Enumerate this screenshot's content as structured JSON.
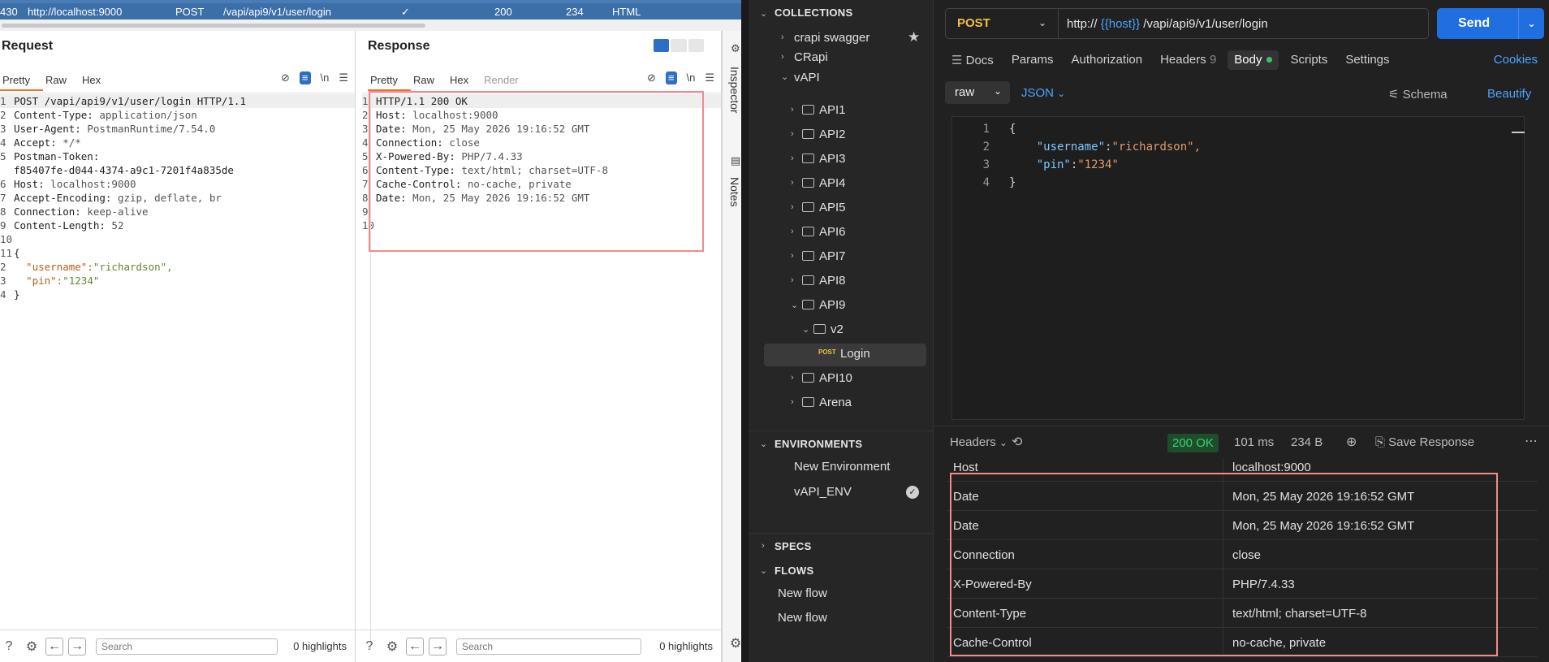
{
  "history": {
    "row": {
      "id": "430",
      "host": "http://localhost:9000",
      "method": "POST",
      "url": "/vapi/api9/v1/user/login",
      "edited": "✓",
      "status": "200",
      "length": "234",
      "mime": "HTML"
    }
  },
  "request": {
    "title": "Request",
    "tabs": [
      "Pretty",
      "Raw",
      "Hex"
    ],
    "lines": [
      {
        "n": "1",
        "k": "POST /vapi/api9/v1/user/login HTTP/1.1",
        "v": ""
      },
      {
        "n": "2",
        "k": "Content-Type:",
        "v": " application/json"
      },
      {
        "n": "3",
        "k": "User-Agent:",
        "v": " PostmanRuntime/7.54.0"
      },
      {
        "n": "4",
        "k": "Accept:",
        "v": " */*"
      },
      {
        "n": "5",
        "k": "Postman-Token:",
        "v": ""
      },
      {
        "n": "",
        "k": "f85407fe-d044-4374-a9c1-7201f4a835de",
        "v": ""
      },
      {
        "n": "6",
        "k": "Host:",
        "v": " localhost:9000"
      },
      {
        "n": "7",
        "k": "Accept-Encoding:",
        "v": " gzip, deflate, br"
      },
      {
        "n": "8",
        "k": "Connection:",
        "v": " keep-alive"
      },
      {
        "n": "9",
        "k": "Content-Length:",
        "v": " 52"
      },
      {
        "n": "10",
        "k": "",
        "v": ""
      },
      {
        "n": "11",
        "k": "{",
        "v": ""
      },
      {
        "n": "2",
        "k": "  \"username\":",
        "v": "\"richardson\","
      },
      {
        "n": "3",
        "k": "  \"pin\":",
        "v": "\"1234\""
      },
      {
        "n": "4",
        "k": "}",
        "v": ""
      }
    ],
    "search_placeholder": "Search",
    "highlights": "0 highlights"
  },
  "response": {
    "title": "Response",
    "tabs": [
      "Pretty",
      "Raw",
      "Hex",
      "Render"
    ],
    "lines": [
      {
        "n": "1",
        "k": "HTTP/1.1 200 OK",
        "v": ""
      },
      {
        "n": "2",
        "k": "Host:",
        "v": " localhost:9000"
      },
      {
        "n": "3",
        "k": "Date:",
        "v": " Mon, 25 May 2026 19:16:52 GMT"
      },
      {
        "n": "4",
        "k": "Connection:",
        "v": " close"
      },
      {
        "n": "5",
        "k": "X-Powered-By:",
        "v": " PHP/7.4.33"
      },
      {
        "n": "6",
        "k": "Content-Type:",
        "v": " text/html; charset=UTF-8"
      },
      {
        "n": "7",
        "k": "Cache-Control:",
        "v": " no-cache, private"
      },
      {
        "n": "8",
        "k": "Date:",
        "v": " Mon, 25 May 2026 19:16:52 GMT"
      },
      {
        "n": "9",
        "k": "",
        "v": ""
      },
      {
        "n": "10",
        "k": "",
        "v": ""
      }
    ],
    "search_placeholder": "Search",
    "highlights": "0 highlights"
  },
  "side": {
    "inspector": "Inspector",
    "notes": "Notes"
  },
  "postman": {
    "collections_label": "COLLECTIONS",
    "collections": [
      {
        "name": "crapi swagger"
      },
      {
        "name": "CRapi"
      },
      {
        "name": "vAPI"
      }
    ],
    "folders": [
      "API1",
      "API2",
      "API3",
      "API4",
      "API5",
      "API6",
      "API7",
      "API8",
      "API9"
    ],
    "subfolder": "v2",
    "request_method": "POST",
    "request_name": "Login",
    "folders_after": [
      "API10",
      "Arena"
    ],
    "environments_label": "ENVIRONMENTS",
    "environments": [
      "New Environment",
      "vAPI_ENV"
    ],
    "specs_label": "SPECS",
    "flows_label": "FLOWS",
    "flows": [
      "New flow",
      "New flow"
    ],
    "method": "POST",
    "url_prefix": "http://",
    "url_var": "{{host}}",
    "url_path": "/vapi/api9/v1/user/login",
    "send": "Send",
    "tabs": [
      "Docs",
      "Params",
      "Authorization",
      "Headers",
      "Body",
      "Scripts",
      "Settings"
    ],
    "headers_count": "9",
    "cookies": "Cookies",
    "body_mode": "raw",
    "body_lang": "JSON",
    "schema": "Schema",
    "beautify": "Beautify",
    "body_lines": [
      {
        "n": "1",
        "k": "{",
        "v": ""
      },
      {
        "n": "2",
        "k": "    \"username\"",
        "v": "\"richardson\","
      },
      {
        "n": "3",
        "k": "    \"pin\"",
        "v": "\"1234\""
      },
      {
        "n": "4",
        "k": "}",
        "v": ""
      }
    ],
    "resp_headers_label": "Headers",
    "status": "200 OK",
    "time": "101 ms",
    "size": "234 B",
    "save_response": "Save Response",
    "resp_headers": [
      {
        "k": "Host",
        "v": "localhost:9000"
      },
      {
        "k": "Date",
        "v": "Mon, 25 May 2026 19:16:52 GMT"
      },
      {
        "k": "Date",
        "v": "Mon, 25 May 2026 19:16:52 GMT"
      },
      {
        "k": "Connection",
        "v": "close"
      },
      {
        "k": "X-Powered-By",
        "v": "PHP/7.4.33"
      },
      {
        "k": "Content-Type",
        "v": "text/html; charset=UTF-8"
      },
      {
        "k": "Cache-Control",
        "v": "no-cache, private"
      }
    ]
  }
}
